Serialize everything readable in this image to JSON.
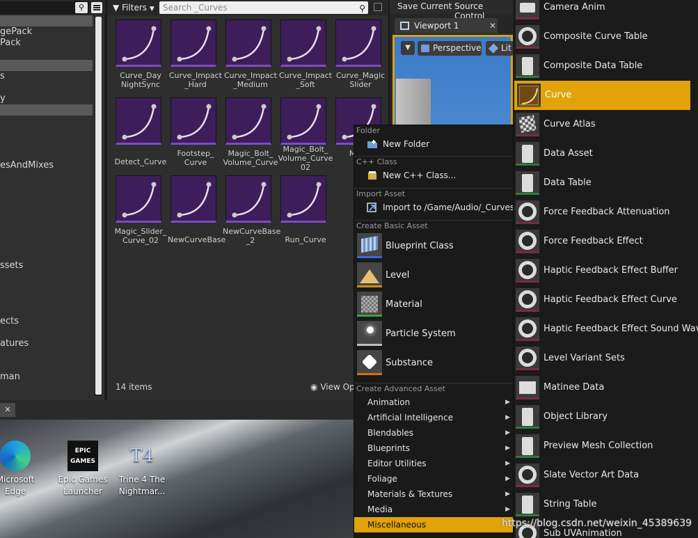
{
  "tree": {
    "rows": [
      {
        "label": "",
        "hl": true
      },
      {
        "label": "gePack",
        "hl": false
      },
      {
        "label": "Pack",
        "hl": false
      },
      {
        "label": "",
        "hl": false
      },
      {
        "label": "",
        "hl": true
      },
      {
        "label": "s",
        "hl": false
      },
      {
        "label": "",
        "hl": false
      },
      {
        "label": "y",
        "hl": false
      },
      {
        "label": "",
        "hl": true
      },
      {
        "label": "",
        "hl": false
      },
      {
        "label": "",
        "hl": false
      },
      {
        "label": "",
        "hl": false
      },
      {
        "label": "",
        "hl": false
      },
      {
        "label": "esAndMixes",
        "hl": false
      },
      {
        "label": "",
        "hl": false
      },
      {
        "label": "",
        "hl": false
      },
      {
        "label": "",
        "hl": false
      },
      {
        "label": "",
        "hl": false
      },
      {
        "label": "",
        "hl": false
      },
      {
        "label": "",
        "hl": false
      },
      {
        "label": "",
        "hl": false
      },
      {
        "label": "",
        "hl": false
      },
      {
        "label": "ssets",
        "hl": false
      },
      {
        "label": "",
        "hl": false
      },
      {
        "label": "",
        "hl": false
      },
      {
        "label": "",
        "hl": false
      },
      {
        "label": "",
        "hl": false
      },
      {
        "label": "ects",
        "hl": false
      },
      {
        "label": "",
        "hl": false
      },
      {
        "label": "atures",
        "hl": false
      },
      {
        "label": "",
        "hl": false
      },
      {
        "label": "",
        "hl": false
      },
      {
        "label": "man",
        "hl": false
      }
    ]
  },
  "assets": {
    "filters_label": "Filters",
    "search_placeholder": "Search _Curves",
    "item_count": "14 items",
    "view_options": "View Op",
    "tiles": [
      [
        "Curve_Day",
        "NightSync"
      ],
      [
        "Curve_Impact",
        "_Hard"
      ],
      [
        "Curve_Impact",
        "_Medium"
      ],
      [
        "Curve_Impact",
        "_Soft"
      ],
      [
        "Curve_Magic",
        "Slider"
      ],
      [
        "Detect_Curve"
      ],
      [
        "Footstep_",
        "Curve"
      ],
      [
        "Magic_Bolt_",
        "Volume_Curve"
      ],
      [
        "Magic_Bolt_",
        "Volume_Curve",
        "02"
      ],
      [
        "Magic",
        "Cur"
      ],
      [
        "Magic_Slider_",
        "Curve_02"
      ],
      [
        "NewCurveBase"
      ],
      [
        "NewCurveBase",
        "_2"
      ],
      [
        "Run_Curve"
      ]
    ]
  },
  "viewport": {
    "save_current": "Save Current",
    "source_control": "Source Control",
    "tab_label": "Viewport 1",
    "perspective": "Perspective",
    "lit": "Lit"
  },
  "context_menu": {
    "sections": {
      "folder": "Folder",
      "cpp": "C++ Class",
      "import": "Import Asset",
      "basic": "Create Basic Asset",
      "advanced": "Create Advanced Asset"
    },
    "new_folder": "New Folder",
    "new_cpp": "New C++ Class...",
    "import_to": "Import to /Game/Audio/_Curves...",
    "basic_assets": [
      "Blueprint Class",
      "Level",
      "Material",
      "Particle System",
      "Substance"
    ],
    "advanced_assets": [
      {
        "label": "Animation",
        "selected": false
      },
      {
        "label": "Artificial Intelligence",
        "selected": false
      },
      {
        "label": "Blendables",
        "selected": false
      },
      {
        "label": "Blueprints",
        "selected": false
      },
      {
        "label": "Editor Utilities",
        "selected": false
      },
      {
        "label": "Foliage",
        "selected": false
      },
      {
        "label": "Materials & Textures",
        "selected": false
      },
      {
        "label": "Media",
        "selected": false
      },
      {
        "label": "Miscellaneous",
        "selected": true
      }
    ]
  },
  "type_list": [
    {
      "label": "Camera Anim",
      "icon": "camera-icon",
      "selected": false
    },
    {
      "label": "Composite Curve Table",
      "icon": "ring-icon",
      "selected": false
    },
    {
      "label": "Composite Data Table",
      "icon": "doc-icon",
      "selected": false
    },
    {
      "label": "Curve",
      "icon": "curve-icon",
      "selected": true
    },
    {
      "label": "Curve Atlas",
      "icon": "checker-icon",
      "selected": false
    },
    {
      "label": "Data Asset",
      "icon": "doc-icon",
      "selected": false
    },
    {
      "label": "Data Table",
      "icon": "doc-icon",
      "selected": false
    },
    {
      "label": "Force Feedback Attenuation",
      "icon": "ring-icon",
      "selected": false
    },
    {
      "label": "Force Feedback Effect",
      "icon": "ring-icon",
      "selected": false
    },
    {
      "label": "Haptic Feedback Effect Buffer",
      "icon": "ring-icon",
      "selected": false
    },
    {
      "label": "Haptic Feedback Effect Curve",
      "icon": "ring-icon",
      "selected": false
    },
    {
      "label": "Haptic Feedback Effect Sound Wave",
      "icon": "ring-icon",
      "selected": false
    },
    {
      "label": "Level Variant Sets",
      "icon": "ring-icon",
      "selected": false
    },
    {
      "label": "Matinee Data",
      "icon": "clapper-icon",
      "selected": false
    },
    {
      "label": "Object Library",
      "icon": "doc-icon",
      "selected": false
    },
    {
      "label": "Preview Mesh Collection",
      "icon": "doc-icon",
      "selected": false
    },
    {
      "label": "Slate Vector Art Data",
      "icon": "ring-icon",
      "selected": false
    },
    {
      "label": "String Table",
      "icon": "doc-icon",
      "selected": false
    },
    {
      "label": "Sub UVAnimation",
      "icon": "ring-icon",
      "selected": false
    }
  ],
  "desktop": {
    "icons": [
      {
        "label": [
          "Microsoft",
          "Edge"
        ],
        "icon": "edge-icon"
      },
      {
        "label": [
          "Epic Games",
          "Launcher"
        ],
        "icon": "epic-games-icon"
      },
      {
        "label": [
          "Trine 4 The",
          "Nightmar..."
        ],
        "icon": "trine-icon"
      }
    ],
    "epic_logo_text": "EPIC GAMES",
    "trine_logo_text": "T4"
  },
  "watermark": "https://blog.csdn.net/weixin_45389639"
}
